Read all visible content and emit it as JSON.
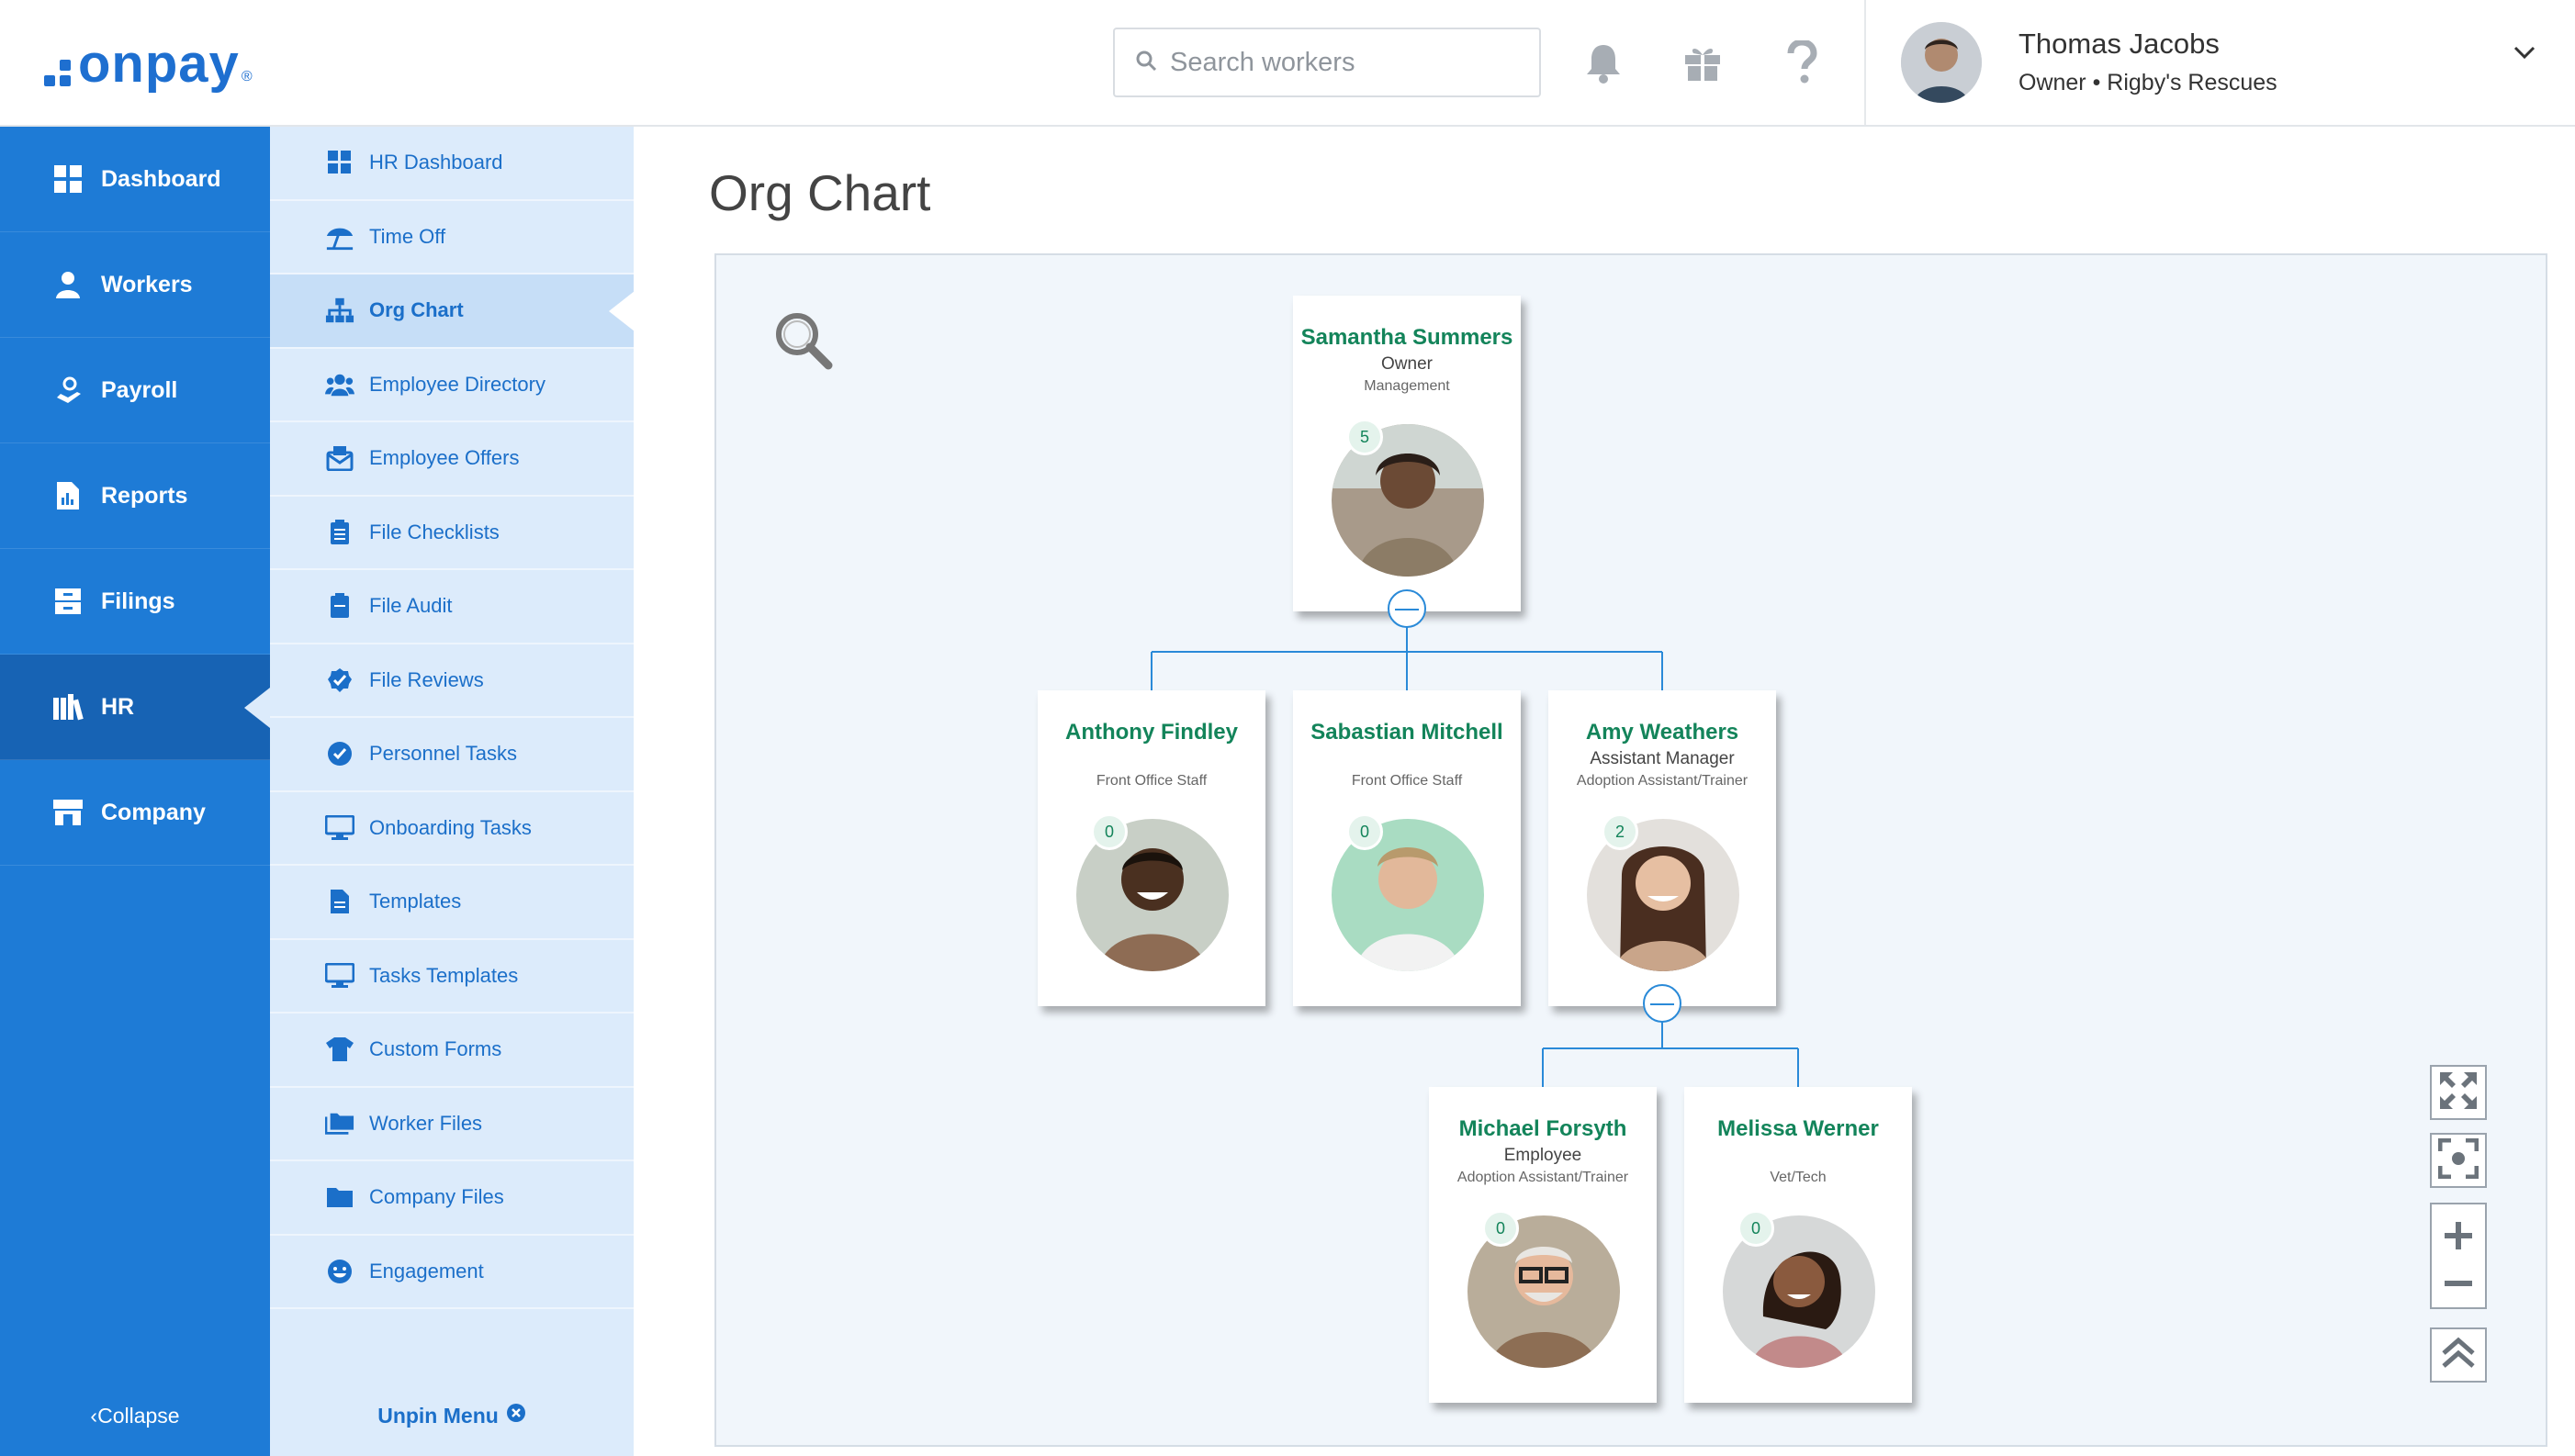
{
  "brand": {
    "logo_text": "onpay",
    "logo_mark": "®",
    "color": "#1e6fd0"
  },
  "header": {
    "search_placeholder": "Search workers",
    "icons": [
      "bell-icon",
      "gift-icon",
      "help-icon"
    ],
    "user": {
      "name": "Thomas Jacobs",
      "role": "Owner • Rigby's Rescues"
    }
  },
  "nav_primary": {
    "items": [
      {
        "label": "Dashboard",
        "icon": "grid-icon"
      },
      {
        "label": "Workers",
        "icon": "worker-icon"
      },
      {
        "label": "Payroll",
        "icon": "payroll-icon"
      },
      {
        "label": "Reports",
        "icon": "report-icon"
      },
      {
        "label": "Filings",
        "icon": "filing-icon"
      },
      {
        "label": "HR",
        "icon": "books-icon",
        "active": true
      },
      {
        "label": "Company",
        "icon": "store-icon"
      }
    ],
    "collapse_label": "Collapse",
    "color": "#1e7bd6"
  },
  "nav_secondary": {
    "items": [
      {
        "label": "HR Dashboard"
      },
      {
        "label": "Time Off"
      },
      {
        "label": "Org Chart",
        "active": true
      },
      {
        "label": "Employee Directory"
      },
      {
        "label": "Employee Offers"
      },
      {
        "label": "File Checklists"
      },
      {
        "label": "File Audit"
      },
      {
        "label": "File Reviews"
      },
      {
        "label": "Personnel Tasks"
      },
      {
        "label": "Onboarding Tasks"
      },
      {
        "label": "Templates"
      },
      {
        "label": "Tasks Templates"
      },
      {
        "label": "Custom Forms"
      },
      {
        "label": "Worker Files"
      },
      {
        "label": "Company Files"
      },
      {
        "label": "Engagement"
      }
    ],
    "unpin_label": "Unpin Menu"
  },
  "page": {
    "title": "Org Chart"
  },
  "org": {
    "people": [
      {
        "id": "p1",
        "name": "Samantha Summers",
        "title": "Owner",
        "dept": "Management",
        "reports": "5"
      },
      {
        "id": "p2",
        "name": "Anthony Findley",
        "title": "",
        "dept": "Front Office Staff",
        "reports": "0"
      },
      {
        "id": "p3",
        "name": "Sabastian Mitchell",
        "title": "",
        "dept": "Front Office Staff",
        "reports": "0"
      },
      {
        "id": "p4",
        "name": "Amy Weathers",
        "title": "Assistant Manager",
        "dept": "Adoption Assistant/Trainer",
        "reports": "2"
      },
      {
        "id": "p5",
        "name": "Michael Forsyth",
        "title": "Employee",
        "dept": "Adoption Assistant/Trainer",
        "reports": "0"
      },
      {
        "id": "p6",
        "name": "Melissa Werner",
        "title": "",
        "dept": "Vet/Tech",
        "reports": "0"
      }
    ],
    "name_color": "#13845a",
    "connector_color": "#2a8ad8"
  },
  "controls": [
    "fullscreen-icon",
    "fit-icon",
    "zoom-in-icon",
    "zoom-out-icon",
    "collapse-all-icon"
  ]
}
